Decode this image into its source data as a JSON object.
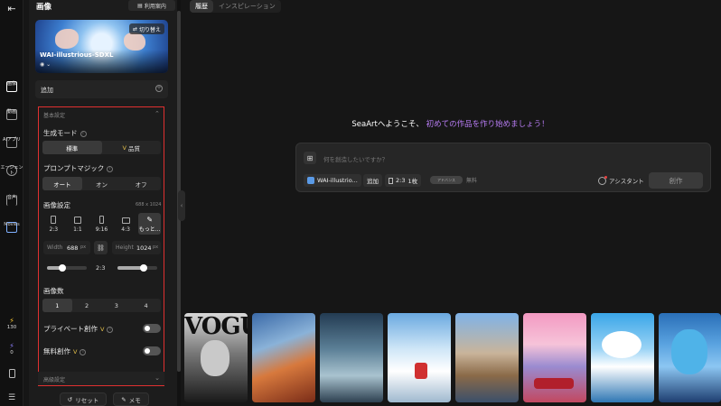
{
  "rail": {
    "items": [
      {
        "label": "画像",
        "icon": "image-icon",
        "active": true
      },
      {
        "label": "動画",
        "icon": "video-icon"
      },
      {
        "label": "AIアプリ",
        "icon": "ai-app-icon"
      },
      {
        "label": "エージェント",
        "icon": "agent-icon"
      },
      {
        "label": "音声",
        "icon": "audio-icon"
      },
      {
        "label": "Movies",
        "icon": "movies-icon"
      }
    ],
    "stats": [
      {
        "icon": "lightning-icon",
        "value": "130"
      },
      {
        "icon": "bolt-icon",
        "value": "0"
      }
    ]
  },
  "panel": {
    "title": "画像",
    "guide_label": "利用案内",
    "model": {
      "name": "WAI-illustrious-SDXL",
      "switch_label": "切り替え"
    },
    "add_label": "追加",
    "basic_header": "基本設定",
    "gen_mode": {
      "label": "生成モード",
      "options": [
        "標準",
        "品質"
      ],
      "selected": 0
    },
    "prompt_magic": {
      "label": "プロンプトマジック",
      "options": [
        "オート",
        "オン",
        "オフ"
      ],
      "selected": 0
    },
    "image_settings": {
      "label": "画像設定",
      "size": "688 x 1024",
      "ratios": [
        "2:3",
        "1:1",
        "9:16",
        "4:3",
        "もっと..."
      ],
      "selected_ratio": 4,
      "width_label": "Width",
      "width_value": "688",
      "height_label": "Height",
      "height_value": "1024",
      "unit": "px",
      "mid_ratio": "2:3"
    },
    "image_count": {
      "label": "画像数",
      "options": [
        "1",
        "2",
        "3",
        "4"
      ],
      "selected": 0
    },
    "private": {
      "label": "プライベート創作"
    },
    "free": {
      "label": "無料創作"
    },
    "advanced_header": "高級設定",
    "reset_label": "リセット",
    "memo_label": "メモ"
  },
  "main": {
    "tabs": [
      "履歴",
      "インスピレーション"
    ],
    "welcome_prefix": "SeaArtへようこそ、",
    "welcome_highlight": "初めての作品を作り始めましょう！",
    "prompt_placeholder": "何を創造したいですか？",
    "chips": {
      "model": "WAI-illustrio...",
      "add": "追加",
      "ratio": "2:3",
      "count": "1枚"
    },
    "free_toggle_text": "アドバンス",
    "free_label": "無料",
    "assistant_label": "アシスタント",
    "create_label": "創作"
  },
  "gallery": {
    "vogue_text": "VOGUE"
  },
  "colors": {
    "accent_purple": "#b77cf3",
    "highlight_red": "#e03030",
    "badge_yellow": "#e6c14a"
  }
}
